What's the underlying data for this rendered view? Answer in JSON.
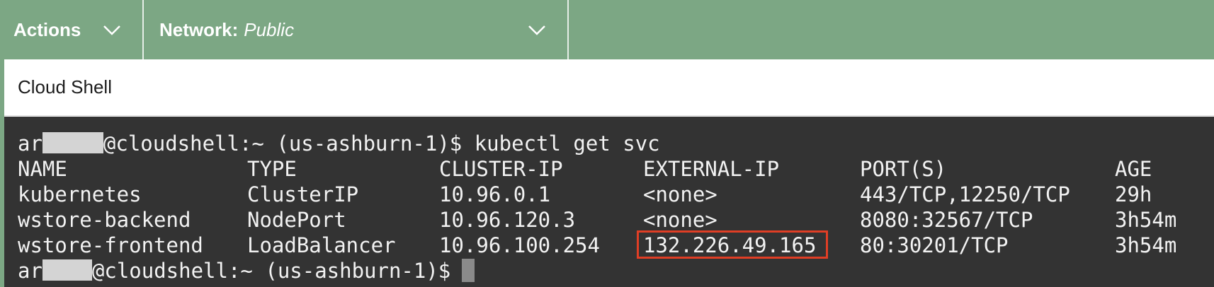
{
  "toolbar": {
    "actions_label": "Actions",
    "network_label": "Network:",
    "network_value": "Public"
  },
  "panel": {
    "title": "Cloud Shell"
  },
  "terminal": {
    "prompt_prefix": "ar",
    "prompt_suffix_1": "@cloudshell:~ (us-ashburn-1)$ ",
    "command": "kubectl get svc",
    "prompt_suffix_2": "@cloudshell:~ (us-ashburn-1)$",
    "headers": [
      "NAME",
      "TYPE",
      "CLUSTER-IP",
      "EXTERNAL-IP",
      "PORT(S)",
      "AGE"
    ],
    "rows": [
      [
        "kubernetes",
        "ClusterIP",
        "10.96.0.1",
        "<none>",
        "443/TCP,12250/TCP",
        "29h"
      ],
      [
        "wstore-backend",
        "NodePort",
        "10.96.120.3",
        "<none>",
        "8080:32567/TCP",
        "3h54m"
      ],
      [
        "wstore-frontend",
        "LoadBalancer",
        "10.96.100.254",
        "132.226.49.165",
        "80:30201/TCP",
        "3h54m"
      ]
    ]
  },
  "colors": {
    "toolbar_bg": "#7ca784",
    "terminal_bg": "#333333",
    "highlight_border": "#e03e25"
  },
  "icons": {
    "actions_dropdown": "chevron-down-icon",
    "network_dropdown": "chevron-down-icon"
  }
}
